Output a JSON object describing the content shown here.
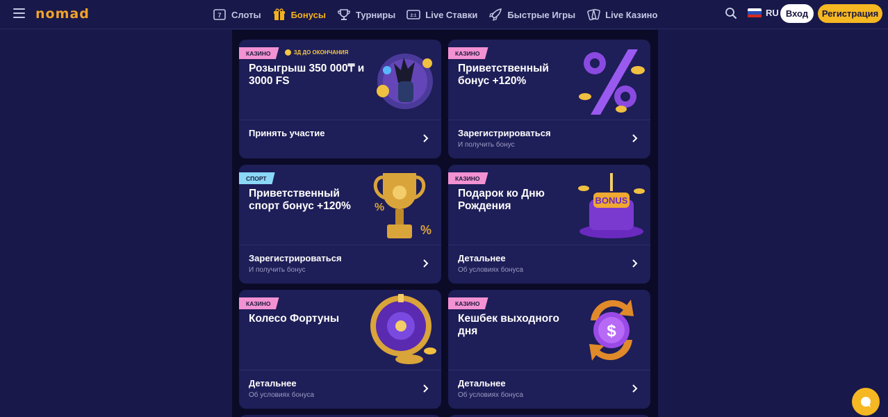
{
  "header": {
    "logo": "nomad",
    "nav": [
      {
        "label": "Слоты",
        "icon": "slots-icon",
        "active": false
      },
      {
        "label": "Бонусы",
        "icon": "gift-icon",
        "active": true
      },
      {
        "label": "Турниры",
        "icon": "trophy-icon",
        "active": false
      },
      {
        "label": "Live Ставки",
        "icon": "scoreboard-icon",
        "active": false
      },
      {
        "label": "Быстрые Игры",
        "icon": "rocket-icon",
        "active": false
      },
      {
        "label": "Live Казино",
        "icon": "cards-icon",
        "active": false
      }
    ],
    "lang": "RU",
    "login_label": "Вход",
    "register_label": "Регистрация"
  },
  "cards": [
    {
      "tag": "КАЗИНО",
      "tag_type": "casino",
      "timer": "3Д ДО ОКОНЧАНИЯ",
      "title": "Розыгрыш 350 000₸ и 3000 FS",
      "action": "Принять участие",
      "sub": "",
      "art": "anubis"
    },
    {
      "tag": "КАЗИНО",
      "tag_type": "casino",
      "timer": "",
      "title": "Приветственный бонус +120%",
      "action": "Зарегистрироваться",
      "sub": "И получить бонус",
      "art": "percent"
    },
    {
      "tag": "СПОРТ",
      "tag_type": "sport",
      "timer": "",
      "title": "Приветственный спорт бонус +120%",
      "action": "Зарегистрироваться",
      "sub": "И получить бонус",
      "art": "cup"
    },
    {
      "tag": "КАЗИНО",
      "tag_type": "casino",
      "timer": "",
      "title": "Подарок ко Дню Рождения",
      "action": "Детальнее",
      "sub": "Об условиях бонуса",
      "art": "cake"
    },
    {
      "tag": "КАЗИНО",
      "tag_type": "casino",
      "timer": "",
      "title": "Колесо Фортуны",
      "action": "Детальнее",
      "sub": "Об условиях бонуса",
      "art": "wheel"
    },
    {
      "tag": "КАЗИНО",
      "tag_type": "casino",
      "timer": "",
      "title": "Кешбек выходного дня",
      "action": "Детальнее",
      "sub": "Об условиях бонуса",
      "art": "cashback"
    }
  ],
  "colors": {
    "accent": "#f5b722",
    "casino_tag": "#f392d2",
    "sport_tag": "#8ad8f6",
    "card_bg": "#1e1e58"
  }
}
